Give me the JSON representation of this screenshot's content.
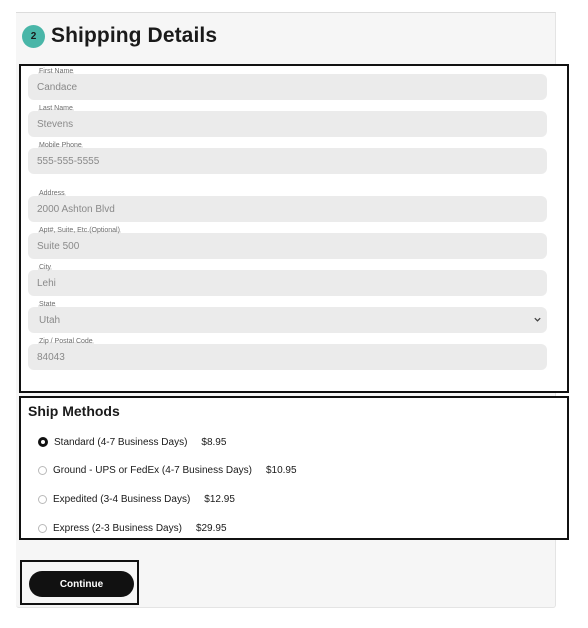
{
  "header": {
    "step_number": "2",
    "title": "Shipping Details"
  },
  "form": {
    "fields": [
      {
        "label": "First Name",
        "value": "Candace"
      },
      {
        "label": "Last Name",
        "value": "Stevens"
      },
      {
        "label": "Mobile Phone",
        "value": "555-555-5555"
      },
      {
        "label": "Address",
        "value": "2000 Ashton Blvd"
      },
      {
        "label": "Apt#, Suite, Etc.(Optional)",
        "value": "Suite 500"
      },
      {
        "label": "City",
        "value": "Lehi"
      },
      {
        "label": "State",
        "value": "Utah"
      },
      {
        "label": "Zip / Postal Code",
        "value": "84043"
      }
    ]
  },
  "ship_methods": {
    "title": "Ship Methods",
    "options": [
      {
        "label": "Standard (4-7 Business Days)",
        "price": "$8.95",
        "selected": true
      },
      {
        "label": "Ground - UPS or FedEx (4-7 Business Days)",
        "price": "$10.95",
        "selected": false
      },
      {
        "label": "Expedited (3-4 Business Days)",
        "price": "$12.95",
        "selected": false
      },
      {
        "label": "Express (2-3 Business Days)",
        "price": "$29.95",
        "selected": false
      }
    ]
  },
  "actions": {
    "continue_label": "Continue"
  },
  "colors": {
    "accent": "#49b6a8",
    "button": "#111111",
    "field_bg": "#ebebeb"
  }
}
